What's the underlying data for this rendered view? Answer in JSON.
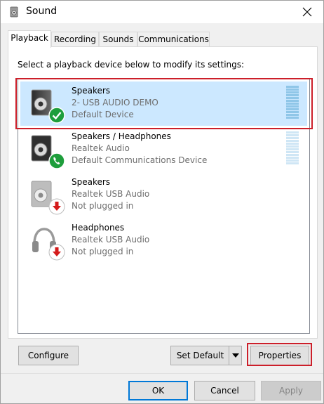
{
  "window": {
    "title": "Sound"
  },
  "tabs": [
    {
      "label": "Playback",
      "active": true
    },
    {
      "label": "Recording",
      "active": false
    },
    {
      "label": "Sounds",
      "active": false
    },
    {
      "label": "Communications",
      "active": false
    }
  ],
  "instruction": "Select a playback device below to modify its settings:",
  "devices": [
    {
      "name": "Speakers",
      "line1": "2- USB AUDIO DEMO",
      "line2": "Default Device",
      "status_icon": "green-check-icon",
      "selected": true
    },
    {
      "name": "Speakers / Headphones",
      "line1": "Realtek Audio",
      "line2": "Default Communications Device",
      "status_icon": "green-phone-icon",
      "selected": false
    },
    {
      "name": "Speakers",
      "line1": "Realtek USB Audio",
      "line2": "Not plugged in",
      "status_icon": "red-down-arrow-icon",
      "selected": false
    },
    {
      "name": "Headphones",
      "line1": "Realtek USB Audio",
      "line2": "Not plugged in",
      "status_icon": "red-down-arrow-icon",
      "selected": false
    }
  ],
  "buttons": {
    "configure": "Configure",
    "set_default": "Set Default",
    "properties": "Properties",
    "ok": "OK",
    "cancel": "Cancel",
    "apply": "Apply"
  },
  "colors": {
    "selection": "#cce8ff",
    "highlight_box": "#cc1f2a",
    "default_button_border": "#0078d7",
    "status_green": "#1e9e3c",
    "status_red": "#d41a1a"
  }
}
